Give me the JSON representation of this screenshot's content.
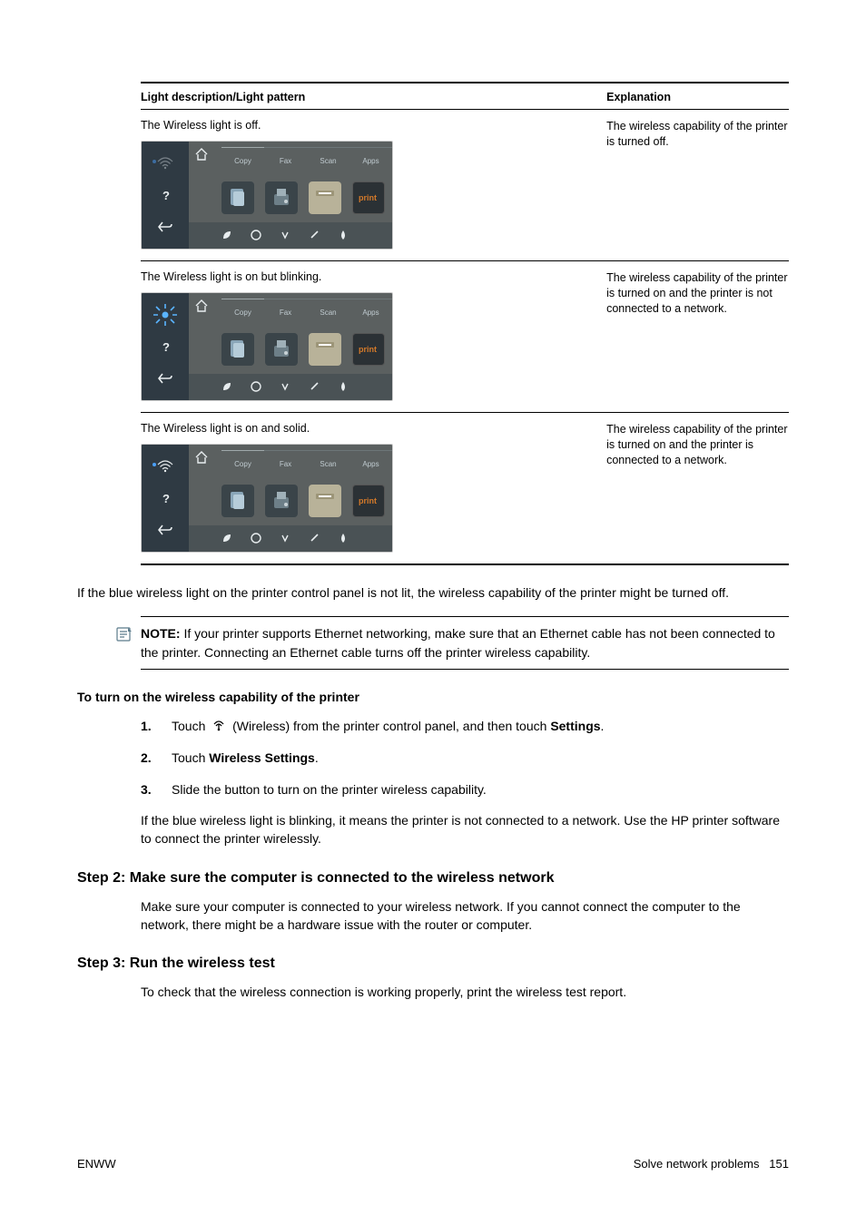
{
  "table": {
    "header_left": "Light description/Light pattern",
    "header_right": "Explanation",
    "rows": [
      {
        "desc": "The Wireless light is off.",
        "exp": "The wireless capability of the printer is turned off.",
        "panel_state": "off"
      },
      {
        "desc": "The Wireless light is on but blinking.",
        "exp": "The wireless capability of the printer is turned on and the printer is not connected to a network.",
        "panel_state": "blinking"
      },
      {
        "desc": "The Wireless light is on and solid.",
        "exp": "The wireless capability of the printer is turned on and the printer is connected to a network.",
        "panel_state": "solid"
      }
    ],
    "panel_labels": {
      "copy": "Copy",
      "fax": "Fax",
      "scan": "Scan",
      "apps": "Apps"
    }
  },
  "body_after_table": "If the blue wireless light on the printer control panel is not lit, the wireless capability of the printer might be turned off.",
  "note": {
    "label": "NOTE:",
    "text": "If your printer supports Ethernet networking, make sure that an Ethernet cable has not been connected to the printer. Connecting an Ethernet cable turns off the printer wireless capability."
  },
  "turn_on_title": "To turn on the wireless capability of the printer",
  "steps_turn_on": [
    {
      "num": "1.",
      "pre": "Touch ",
      "post": " (Wireless) from the printer control panel, and then touch ",
      "bold_end": "Settings",
      "tail": "."
    },
    {
      "num": "2.",
      "pre": "Touch ",
      "bold_end": "Wireless Settings",
      "tail": "."
    },
    {
      "num": "3.",
      "pre": "Slide the button to turn on the printer wireless capability."
    }
  ],
  "after_steps_p": "If the blue wireless light is blinking, it means the printer is not connected to a network. Use the HP printer software to connect the printer wirelessly.",
  "step2_title": "Step 2: Make sure the computer is connected to the wireless network",
  "step2_body": "Make sure your computer is connected to your wireless network. If you cannot connect the computer to the network, there might be a hardware issue with the router or computer.",
  "step3_title": "Step 3: Run the wireless test",
  "step3_body": "To check that the wireless connection is working properly, print the wireless test report.",
  "footer": {
    "left": "ENWW",
    "right_label": "Solve network problems",
    "right_page": "151"
  }
}
